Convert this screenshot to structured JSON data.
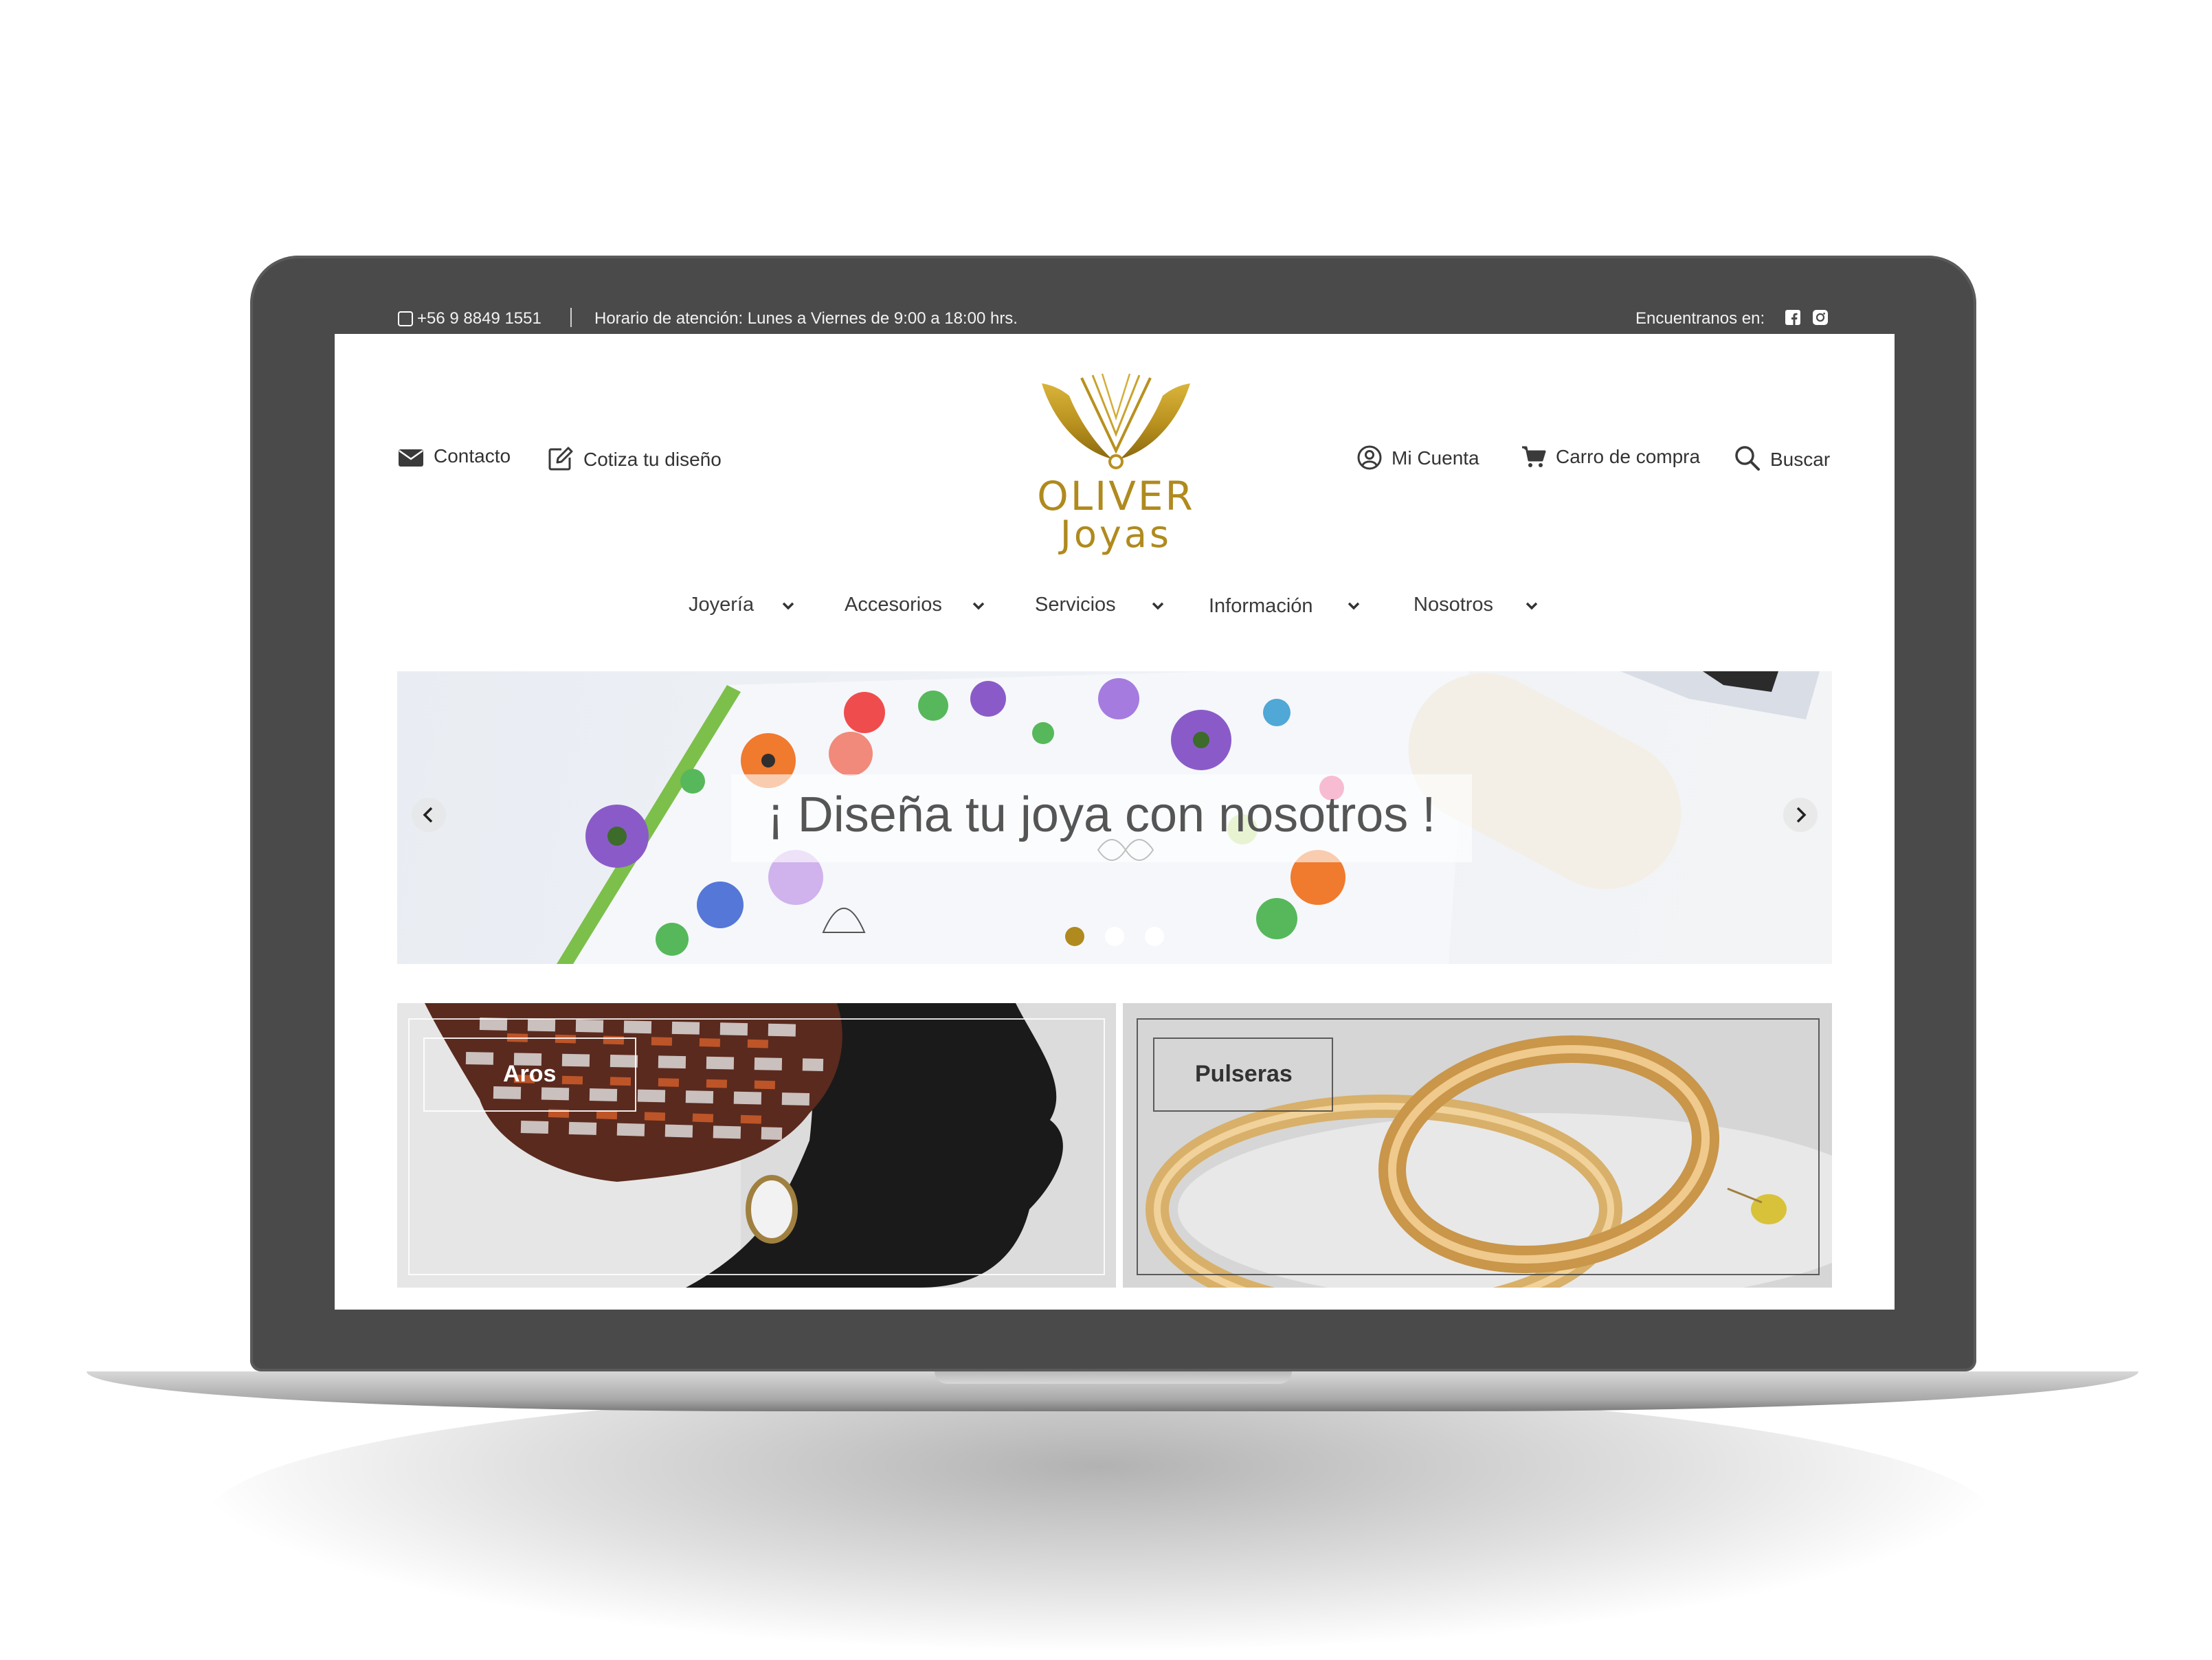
{
  "topbar": {
    "phone": "+56 9 8849 1551",
    "hours": "Horario de atención: Lunes a Viernes de 9:00 a 18:00 hrs.",
    "social_label": "Encuentranos en:",
    "social_icons": [
      "facebook-icon",
      "instagram-icon"
    ]
  },
  "header": {
    "contact": "Contacto",
    "quote": "Cotiza tu diseño",
    "account": "Mi Cuenta",
    "cart": "Carro de compra",
    "search": "Buscar",
    "logo_line1": "OLIVER",
    "logo_line2": "Joyas"
  },
  "nav": {
    "items": [
      {
        "label": "Joyería"
      },
      {
        "label": "Accesorios"
      },
      {
        "label": "Servicios"
      },
      {
        "label": "Información"
      },
      {
        "label": "Nosotros"
      }
    ]
  },
  "hero": {
    "caption": "¡ Diseña tu joya con nosotros !",
    "slides": 3,
    "active_slide": 1
  },
  "categories": [
    {
      "label": "Aros"
    },
    {
      "label": "Pulseras"
    }
  ],
  "colors": {
    "brand_gold": "#b08a1e",
    "topbar_bg": "#4a4a4a",
    "text": "#333333"
  }
}
